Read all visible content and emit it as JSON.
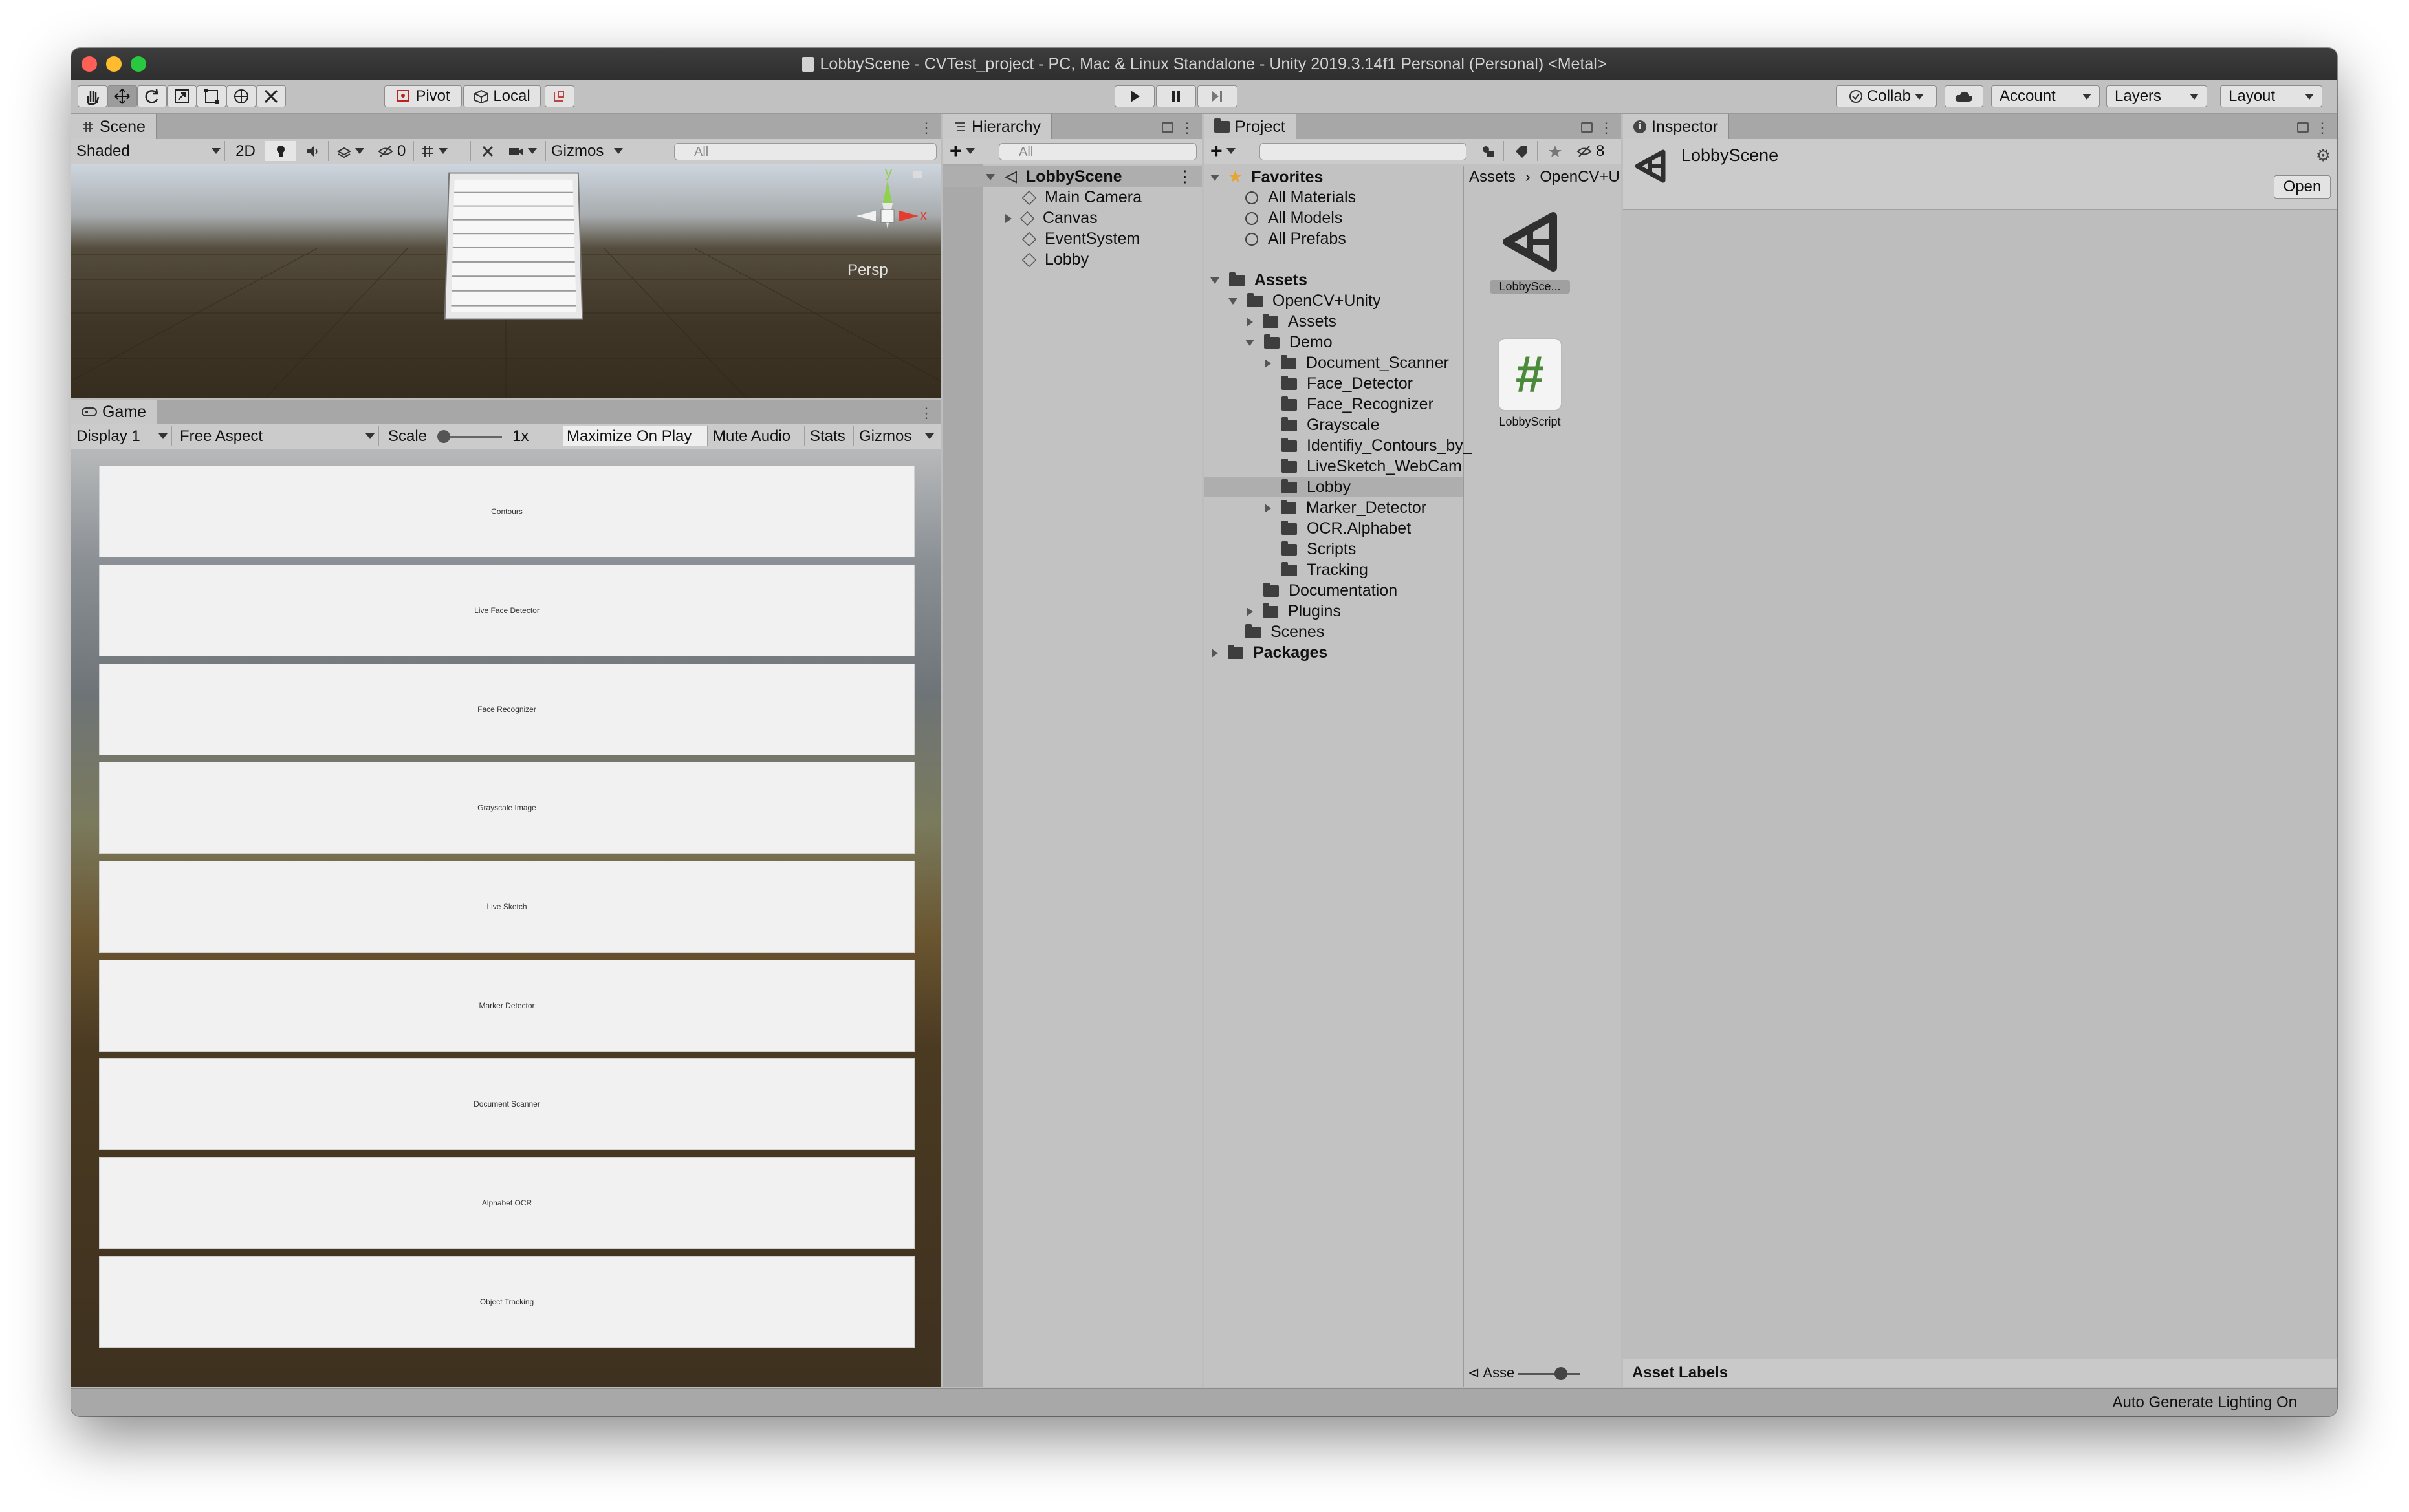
{
  "window": {
    "title": "LobbyScene - CVTest_project - PC, Mac & Linux Standalone - Unity 2019.3.14f1 Personal (Personal) <Metal>",
    "traffic_colors": [
      "#ff5f57",
      "#febc2e",
      "#28c840"
    ]
  },
  "toolbar": {
    "pivot": "Pivot",
    "local": "Local",
    "collab": "Collab",
    "account": "Account",
    "layers": "Layers",
    "layout": "Layout",
    "tools": [
      "hand-icon",
      "move-icon",
      "rotate-icon",
      "scale-icon",
      "rect-icon",
      "transform-icon",
      "custom-tool-icon"
    ],
    "play_controls": [
      "play-icon",
      "pause-icon",
      "step-icon"
    ]
  },
  "scene": {
    "tab": "Scene",
    "shading": "Shaded",
    "mode2d": "2D",
    "hidden_count": "0",
    "gizmos": "Gizmos",
    "search_placeholder": "All",
    "persp": "Persp",
    "axis_y": "y",
    "axis_x": "x"
  },
  "game": {
    "tab": "Game",
    "display": "Display 1",
    "aspect": "Free Aspect",
    "scale_label": "Scale",
    "scale_value": "1x",
    "maximize": "Maximize On Play",
    "mute": "Mute Audio",
    "stats": "Stats",
    "gizmos": "Gizmos",
    "buttons": [
      "Contours",
      "Live Face Detector",
      "Face Recognizer",
      "Grayscale Image",
      "Live Sketch",
      "Marker Detector",
      "Document Scanner",
      "Alphabet OCR",
      "Object Tracking"
    ]
  },
  "hierarchy": {
    "tab": "Hierarchy",
    "search_placeholder": "All",
    "scene_name": "LobbyScene",
    "items": [
      "Main Camera",
      "Canvas",
      "EventSystem",
      "Lobby"
    ]
  },
  "project": {
    "tab": "Project",
    "hidden_count": "8",
    "favorites_label": "Favorites",
    "favorites": [
      "All Materials",
      "All Models",
      "All Prefabs"
    ],
    "assets_label": "Assets",
    "tree": {
      "opencv": "OpenCV+Unity",
      "assets": "Assets",
      "demo": "Demo",
      "demo_children": [
        "Document_Scanner",
        "Face_Detector",
        "Face_Recognizer",
        "Grayscale",
        "Identifiy_Contours_by_",
        "LiveSketch_WebCam",
        "Lobby",
        "Marker_Detector",
        "OCR.Alphabet",
        "Scripts",
        "Tracking"
      ],
      "documentation": "Documentation",
      "plugins": "Plugins",
      "scenes": "Scenes"
    },
    "packages_label": "Packages",
    "breadcrumb_root": "Assets",
    "breadcrumb_child": "OpenCV+U",
    "grid_items": [
      "LobbySce...",
      "LobbyScript"
    ],
    "slider_label": "Asse"
  },
  "inspector": {
    "tab": "Inspector",
    "object_name": "LobbyScene",
    "open_button": "Open",
    "asset_labels": "Asset Labels"
  },
  "status": {
    "text": "Auto Generate Lighting On"
  }
}
